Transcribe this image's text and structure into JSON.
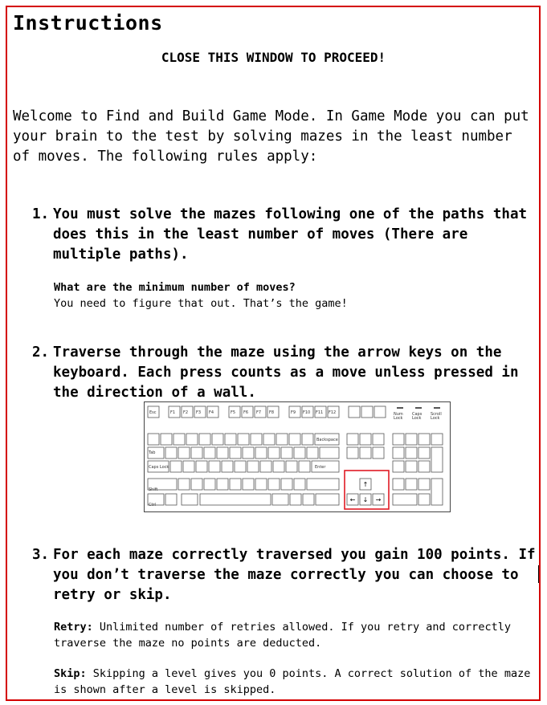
{
  "dialog": {
    "title": "Instructions",
    "close_note": "CLOSE THIS WINDOW TO PROCEED!",
    "welcome": "Welcome to Find and Build Game Mode. In Game Mode you can put your brain to the test by solving mazes in the least number of moves. The following rules apply:",
    "rules": [
      {
        "number": "1.",
        "text": "You must solve the mazes following one of the paths that does this in the least number of moves (There are multiple paths).",
        "sub_heading": "What are the minimum number of moves?",
        "sub_text": "You need to figure that out. That’s the game!"
      },
      {
        "number": "2.",
        "text": "Traverse through the maze using the arrow keys on the keyboard. Each press counts as a move unless pressed in the direction of a wall."
      },
      {
        "number": "3.",
        "text": "For each maze correctly traversed you gain 100 points. If you don’t traverse the maze correctly you can choose to retry or skip.",
        "retry_label": "Retry:",
        "retry_text": " Unlimited number of retries allowed. If you retry and correctly traverse the maze no points are deducted.",
        "skip_label": "Skip:",
        "skip_text": " Skipping a level gives you 0 points. A correct solution of the maze is shown after a level is skipped."
      }
    ]
  },
  "keyboard": {
    "icon": "keyboard-illustration",
    "highlight_color": "#e01b24",
    "function_row": [
      "Esc",
      "F1",
      "F2",
      "F3",
      "F4",
      "F5",
      "F6",
      "F7",
      "F8",
      "F9",
      "F10",
      "F11",
      "F12"
    ],
    "lock_labels": [
      "Num Lock",
      "Caps Lock",
      "Scroll Lock"
    ],
    "arrow_keys": [
      "↑",
      "←",
      "↓",
      "→"
    ]
  },
  "colors": {
    "border": "#d40000",
    "background": "#ffffff",
    "text": "#000000"
  }
}
